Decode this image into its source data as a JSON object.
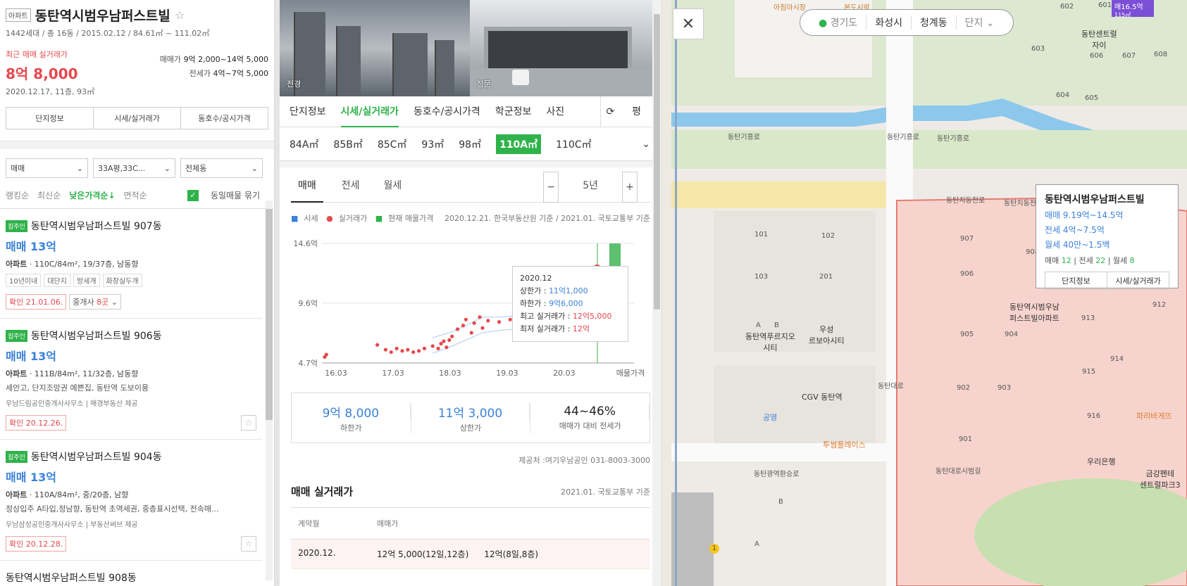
{
  "complex": {
    "type_tag": "아파트",
    "name": "동탄역시범우남퍼스트빌",
    "summary": "1442세대 / 총 16동 / 2015.02.12 / 84.61㎡ ~ 111.02㎡",
    "recent_label": "최근 매매 실거래가",
    "recent_price": "8억 8,000",
    "recent_detail": "2020.12.17, 11층, 93㎡",
    "sale_label": "매매가",
    "sale_range": "9억 2,000~14억 5,000",
    "jeonse_label": "전세가",
    "jeonse_range": "4억~7억 5,000"
  },
  "left_tabs": [
    "단지정보",
    "시세/실거래가",
    "동호수/공시가격"
  ],
  "filters": {
    "trade": "매매",
    "area": "33A평,33C...",
    "dong": "전체동"
  },
  "sort": {
    "items": [
      "랭킹순",
      "최신순",
      "낮은가격순↓",
      "면적순"
    ],
    "group_label": "동일매물 묶기"
  },
  "listings": [
    {
      "badge": "집주인",
      "name": "동탄역시범우남퍼스트빌 907동",
      "price": "매매 13억",
      "type": "아파트",
      "detail": "110C/84m², 19/37층, 남동향",
      "chips": [
        "10년이내",
        "대단지",
        "방세개",
        "화장실두개"
      ],
      "confirm": "확인 21.01.06.",
      "agents_label": "중개사",
      "agents_count": "8곳"
    },
    {
      "badge": "집주인",
      "name": "동탄역시범우남퍼스트빌 906동",
      "price": "매매 13억",
      "type": "아파트",
      "detail": "111B/84m², 11/32층, 남동향",
      "features": "세안고, 단지조망권 예쁜집, 동탄역 도보이용",
      "agency": "우남드림공인중개사사무소",
      "provider": "매경부동산 제공",
      "confirm": "확인 20.12.26."
    },
    {
      "badge": "집주인",
      "name": "동탄역시범우남퍼스트빌 904동",
      "price": "매매 13억",
      "type": "아파트",
      "detail": "110A/84m², 중/20층, 남향",
      "features": "정상입주 A타입,정남향, 동탄역 초역세권, 중층표시선택, 전속매...",
      "agency": "우남삼성공인중개사사무소",
      "provider": "부동산써브 제공",
      "confirm": "확인 20.12.28."
    },
    {
      "name": "동탄역시범우남퍼스트빌 908동"
    }
  ],
  "photos": {
    "left_label": "전경",
    "right_label": "정문"
  },
  "main_tabs": [
    "단지정보",
    "시세/실거래가",
    "동호수/공시가격",
    "학군정보",
    "사진"
  ],
  "pyeong_label": "평",
  "sizes": [
    "84A㎡",
    "85B㎡",
    "85C㎡",
    "93㎡",
    "98㎡",
    "110A㎡",
    "110C㎡"
  ],
  "deal_tabs": [
    "매매",
    "전세",
    "월세"
  ],
  "period": "5년",
  "legend": {
    "s1": "시세",
    "s2": "실거래가",
    "s3": "현재 매물가격",
    "note": "2020.12.21. 한국부동산원 기준 / 2021.01. 국토교통부 기준"
  },
  "chart_data": {
    "type": "scatter",
    "y_ticks": [
      "14.6억",
      "9.6억",
      "4.7억"
    ],
    "x_ticks": [
      "16.03",
      "17.03",
      "18.03",
      "19.03",
      "20.03",
      "매물가격"
    ],
    "ylim": [
      4.7,
      14.6
    ],
    "xlim": [
      2016.0,
      2021.0
    ],
    "real_trades": [
      [
        2016.05,
        5.2
      ],
      [
        2016.08,
        5.4
      ],
      [
        2017.0,
        6.2
      ],
      [
        2017.15,
        5.8
      ],
      [
        2017.25,
        5.6
      ],
      [
        2017.35,
        5.9
      ],
      [
        2017.45,
        5.7
      ],
      [
        2017.55,
        5.8
      ],
      [
        2017.65,
        5.6
      ],
      [
        2017.75,
        5.7
      ],
      [
        2017.85,
        5.9
      ],
      [
        2018.0,
        6.1
      ],
      [
        2018.1,
        5.9
      ],
      [
        2018.15,
        6.3
      ],
      [
        2018.2,
        6.5
      ],
      [
        2018.25,
        6.0
      ],
      [
        2018.3,
        6.6
      ],
      [
        2018.35,
        6.9
      ],
      [
        2018.45,
        7.5
      ],
      [
        2018.55,
        7.8
      ],
      [
        2018.6,
        8.3
      ],
      [
        2018.7,
        7.2
      ],
      [
        2018.75,
        8.0
      ],
      [
        2018.85,
        8.5
      ],
      [
        2018.9,
        7.6
      ],
      [
        2019.0,
        8.2
      ],
      [
        2019.2,
        8.1
      ],
      [
        2019.4,
        8.3
      ],
      [
        2020.95,
        12.0
      ],
      [
        2020.97,
        12.5
      ]
    ],
    "price_upper": [
      [
        2018.0,
        6.8
      ],
      [
        2018.3,
        7.2
      ],
      [
        2018.6,
        7.8
      ],
      [
        2018.9,
        8.5
      ],
      [
        2019.2,
        8.5
      ],
      [
        2019.5,
        8.6
      ],
      [
        2019.8,
        8.8
      ],
      [
        2020.1,
        9.0
      ],
      [
        2020.4,
        9.4
      ],
      [
        2020.7,
        10.2
      ],
      [
        2020.97,
        11.1
      ]
    ],
    "price_lower": [
      [
        2018.0,
        5.5
      ],
      [
        2018.3,
        6.0
      ],
      [
        2018.6,
        6.6
      ],
      [
        2018.9,
        7.2
      ],
      [
        2019.2,
        7.4
      ],
      [
        2019.5,
        7.5
      ],
      [
        2019.8,
        7.7
      ],
      [
        2020.1,
        8.0
      ],
      [
        2020.4,
        8.4
      ],
      [
        2020.7,
        9.0
      ],
      [
        2020.97,
        9.6
      ]
    ],
    "listing_range": [
      12.0,
      14.6
    ],
    "tooltip": {
      "date": "2020.12",
      "upper_label": "상한가 : ",
      "upper": "11억1,000",
      "lower_label": "하한가 : ",
      "lower": "9억6,000",
      "max_label": "최고 실거래가 : ",
      "max": "12억5,000",
      "min_label": "최저 실거래가 : ",
      "min": "12억"
    }
  },
  "summary_box": [
    {
      "value": "9억 8,000",
      "caption": "하한가"
    },
    {
      "value": "11억 3,000",
      "caption": "상한가"
    },
    {
      "value": "44~46%",
      "caption": "매매가 대비 전세가"
    }
  ],
  "provider_note": "제공처 :여기우남공인 031-8003-3000",
  "trades": {
    "title": "매매 실거래가",
    "note": "2021.01. 국토교통부 기준",
    "col1": "계약월",
    "col2": "매매가",
    "row": {
      "month": "2020.12.",
      "p1": "12억 5,000(12일,12층)",
      "p2": "12억(8일,8층)"
    }
  },
  "map": {
    "location": [
      "경기도",
      "화성시",
      "청계동",
      "단지"
    ],
    "popup": {
      "title": "동탄역시범우남퍼스트빌",
      "sale": "매매 9.19억~14.5억",
      "jeonse": "전세 4억~7.5억",
      "monthly": "월세 40만~1.5백",
      "count_sale_label": "매매",
      "count_sale": "12",
      "count_jeonse_label": "전세",
      "count_jeonse": "22",
      "count_monthly_label": "월세",
      "count_monthly": "8",
      "btn1": "단지정보",
      "btn2": "시세/실거래가"
    },
    "labels": {
      "road1": "동탄기흥로",
      "road2": "동탄기흥로",
      "road3": "동탄기흥로",
      "road4": "동탄치동천로",
      "road5": "동탄치동천로",
      "road6": "동탄광역환승로",
      "road7": "동탄대로시범길",
      "road8": "동탄대로",
      "b101": "101",
      "b102": "102",
      "b103": "103",
      "b201": "201",
      "poi1": "동탄역푸르지오\n시티",
      "poi2": "우성\n르보아시티",
      "poi3": "CGV 동탄역",
      "poi4": "공영",
      "poi5": "투썸플레이스",
      "poi6": "동탄역시범우남\n퍼스트빌아파트",
      "poi7": "파리바게뜨",
      "poi8": "우리은행",
      "poi9": "금강펜테\n센트럴파크3",
      "poi10": "동탄센트럴\n자이",
      "marker": "매16.5억",
      "marker_sub": "115㎡",
      "d907": "907",
      "d908": "908",
      "d906": "906",
      "d905": "905",
      "d904": "904",
      "d913": "913",
      "d912": "912",
      "d914": "914",
      "d915": "915",
      "d902": "902",
      "d903": "903",
      "d916": "916",
      "d901": "901",
      "n602": "602",
      "n601": "601",
      "n603": "603",
      "n606": "606",
      "n607": "607",
      "n608": "608",
      "n604": "604",
      "n605": "605",
      "blockA": "A",
      "blockB": "B",
      "blockA2": "A",
      "blockB2": "B",
      "station_no": "1",
      "top_label1": "아침마시장",
      "top_label2": "본도시락"
    }
  }
}
